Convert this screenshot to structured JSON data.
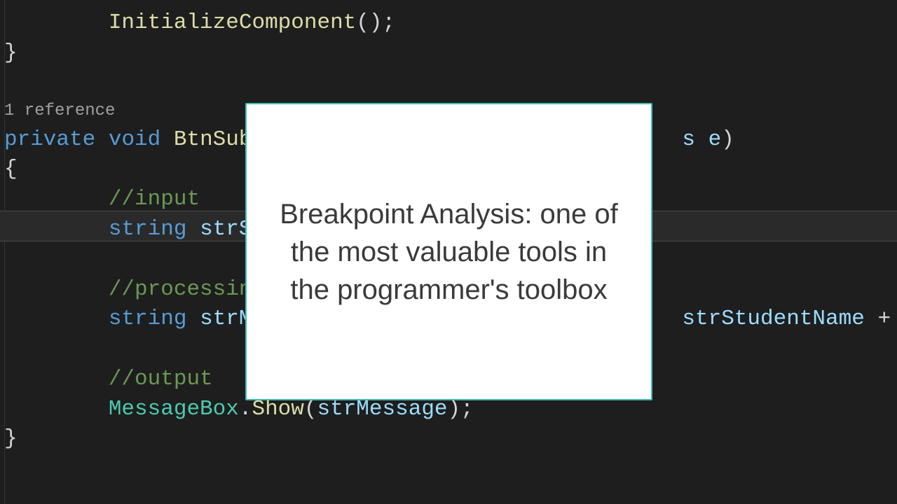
{
  "editor": {
    "line0": "        InitializeComponent();",
    "line1": "}",
    "refs": "1 reference",
    "sig_private": "private",
    "sig_void": "void",
    "sig_name_vis_l": "BtnSub",
    "sig_name_vis_r": "s e)",
    "brace_open": "{",
    "cm_input": "//input",
    "kw_string1": "string",
    "var_stud": "strStude",
    "cm_proc": "//processing",
    "kw_string2": "string",
    "var_msg_l": "strMessa",
    "var_stud_r": "strStudentName",
    "plus": " + ",
    "dot_q": "\".\"",
    "cm_out": "//output",
    "mb_type": "MessageBox",
    "mb_dot": ".",
    "mb_show": "Show",
    "mb_open": "(",
    "mb_arg": "strMessage",
    "mb_close": ");",
    "brace_close": "}"
  },
  "modal": {
    "text": "Breakpoint Analysis: one of the most valuable tools in the programmer's toolbox"
  }
}
